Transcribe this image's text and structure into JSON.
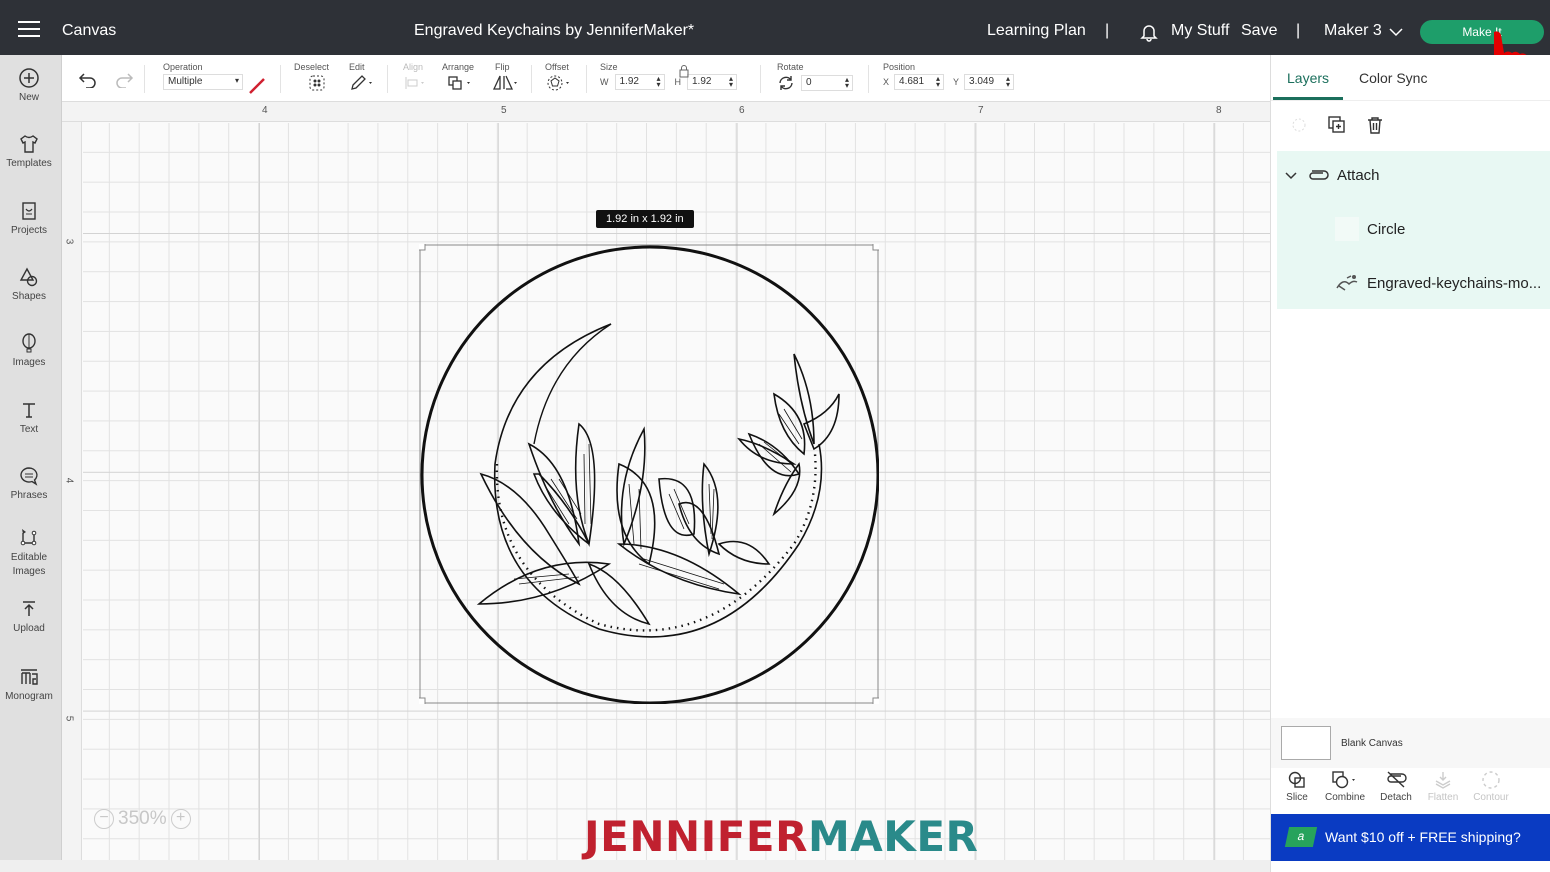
{
  "topbar": {
    "app_title": "Canvas",
    "doc_title": "Engraved Keychains by JenniferMaker*",
    "learning_plan": "Learning Plan",
    "separator": "|",
    "my_stuff": "My Stuff",
    "save": "Save",
    "machine": "Maker 3",
    "make_it": "Make It",
    "colors": {
      "bar": "#2e3137",
      "make_it": "#1e9e6a"
    }
  },
  "leftnav": {
    "items": [
      {
        "label": "New",
        "icon": "plus-circle-icon"
      },
      {
        "label": "Templates",
        "icon": "tshirt-icon"
      },
      {
        "label": "Projects",
        "icon": "projects-icon"
      },
      {
        "label": "Shapes",
        "icon": "shapes-icon"
      },
      {
        "label": "Images",
        "icon": "balloon-icon"
      },
      {
        "label": "Text",
        "icon": "text-icon"
      },
      {
        "label": "Phrases",
        "icon": "speech-bubble-icon"
      },
      {
        "label": "Editable Images",
        "icon": "editable-images-icon"
      },
      {
        "label": "Upload",
        "icon": "upload-icon"
      },
      {
        "label": "Monogram",
        "icon": "monogram-icon"
      }
    ]
  },
  "toolbar": {
    "operation_label": "Operation",
    "operation_value": "Multiple",
    "deselect_label": "Deselect",
    "edit_label": "Edit",
    "align_label": "Align",
    "arrange_label": "Arrange",
    "flip_label": "Flip",
    "offset_label": "Offset",
    "size_label": "Size",
    "w_label": "W",
    "w_value": "1.92",
    "h_label": "H",
    "h_value": "1.92",
    "rotate_label": "Rotate",
    "rotate_value": "0",
    "position_label": "Position",
    "x_label": "X",
    "x_value": "4.681",
    "y_label": "Y",
    "y_value": "3.049"
  },
  "canvas": {
    "ruler_top": [
      "4",
      "5",
      "6",
      "7",
      "8"
    ],
    "ruler_left": [
      "3",
      "4",
      "5"
    ],
    "dimension_tooltip": "1.92  in x 1.92  in",
    "zoom_level": "350%",
    "zoom_out": "−",
    "zoom_in": "+",
    "watermark_a": "JENNIFER",
    "watermark_b": "MAKER"
  },
  "right_panel": {
    "tabs": [
      {
        "label": "Layers",
        "active": true
      },
      {
        "label": "Color Sync",
        "active": false
      }
    ],
    "layers": {
      "group": "Attach",
      "children": [
        "Circle",
        "Engraved-keychains-mo..."
      ]
    },
    "blank_canvas": "Blank Canvas",
    "bottom_tools": [
      {
        "label": "Slice",
        "enabled": true
      },
      {
        "label": "Combine",
        "enabled": true
      },
      {
        "label": "Detach",
        "enabled": true
      },
      {
        "label": "Flatten",
        "enabled": false
      },
      {
        "label": "Contour",
        "enabled": false
      }
    ],
    "promo_badge": "a",
    "promo_text": "Want $10 off + FREE shipping?"
  }
}
